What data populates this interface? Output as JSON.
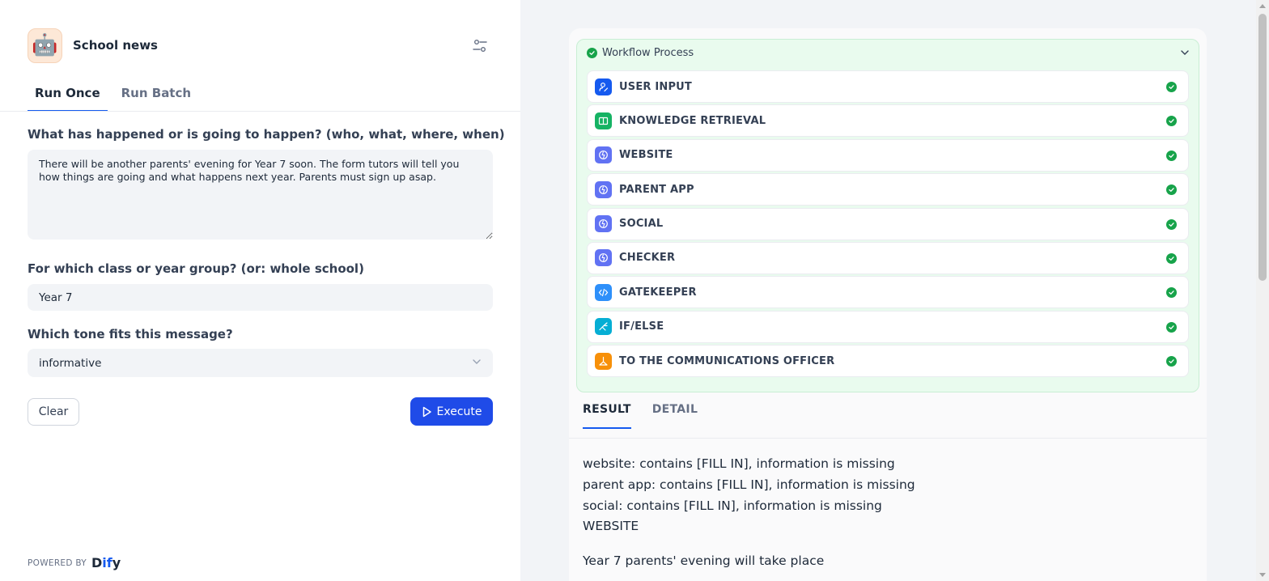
{
  "app": {
    "title": "School news",
    "icon": "robot-emoji",
    "icon_glyph": "🤖"
  },
  "tabs": [
    {
      "label": "Run Once",
      "active": true
    },
    {
      "label": "Run Batch",
      "active": false
    }
  ],
  "form": {
    "field1": {
      "label": "What has happened or is going to happen? (who, what, where, when)",
      "value": "There will be another parents' evening for Year 7 soon. The form tutors will tell you how things are going and what happens next year. Parents must sign up asap."
    },
    "field2": {
      "label": "For which class or year group? (or: whole school)",
      "value": "Year 7"
    },
    "field3": {
      "label": "Which tone fits this message?",
      "value": "informative"
    },
    "clear_label": "Clear",
    "execute_label": "Execute"
  },
  "powered": {
    "prefix": "POWERED BY",
    "brand_d": "D",
    "brand_if": "if",
    "brand_y": "y"
  },
  "workflow": {
    "title": "Workflow Process",
    "status": "succeeded",
    "nodes": [
      {
        "label": "USER INPUT",
        "icon": "user-input-icon",
        "color": "#155aef"
      },
      {
        "label": "KNOWLEDGE RETRIEVAL",
        "icon": "book-icon",
        "color": "#16b364"
      },
      {
        "label": "WEBSITE",
        "icon": "llm-icon",
        "color": "#6172f3"
      },
      {
        "label": "PARENT APP",
        "icon": "llm-icon",
        "color": "#6172f3"
      },
      {
        "label": "SOCIAL",
        "icon": "llm-icon",
        "color": "#6172f3"
      },
      {
        "label": "CHECKER",
        "icon": "llm-icon",
        "color": "#6172f3"
      },
      {
        "label": "GATEKEEPER",
        "icon": "code-icon",
        "color": "#2e90fa"
      },
      {
        "label": "IF/ELSE",
        "icon": "branch-icon",
        "color": "#06aed4"
      },
      {
        "label": "TO THE COMMUNICATIONS OFFICER",
        "icon": "answer-icon",
        "color": "#f79009"
      }
    ]
  },
  "result_tabs": [
    {
      "label": "RESULT",
      "active": true
    },
    {
      "label": "DETAIL",
      "active": false
    }
  ],
  "result": {
    "lines": [
      "website: contains [FILL IN], information is missing",
      "parent app: contains [FILL IN], information is missing",
      "social: contains [FILL IN], information is missing",
      "WEBSITE"
    ],
    "paragraph": "Year 7 parents' evening will take place"
  },
  "colors": {
    "accent": "#155aef",
    "success": "#17a34a",
    "workflow_bg": "#e9fbee"
  }
}
